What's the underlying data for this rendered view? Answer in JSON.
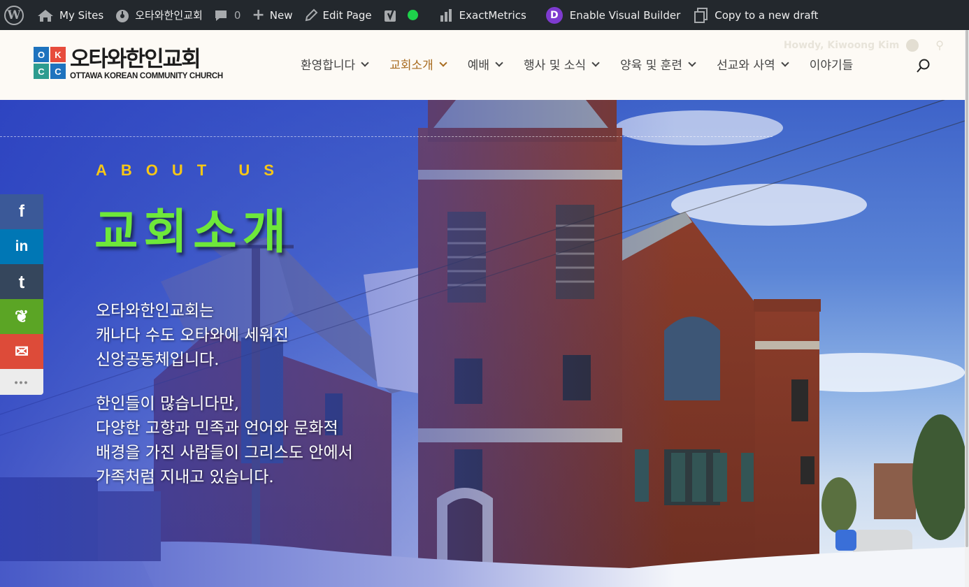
{
  "adminbar": {
    "wp_icon": "wordpress-logo-icon",
    "my_sites": "My Sites",
    "site_name": "오타와한인교회",
    "comments_count": "0",
    "new_label": "New",
    "edit_page": "Edit Page",
    "exactmetrics": "ExactMetrics",
    "visual_builder": "Enable Visual Builder",
    "copy_draft": "Copy to a new draft",
    "divi_letter": "D"
  },
  "header": {
    "logo_ko": "오타와한인교회",
    "logo_en": "OTTAWA KOREAN COMMUNITY CHURCH",
    "logo_letters": [
      "O",
      "K",
      "C",
      "C"
    ],
    "howdy": "Howdy, Kiwoong Kim",
    "nav": [
      {
        "label": "환영합니다",
        "has_dropdown": true,
        "active": false
      },
      {
        "label": "교회소개",
        "has_dropdown": true,
        "active": true
      },
      {
        "label": "예배",
        "has_dropdown": true,
        "active": false
      },
      {
        "label": "행사 및 소식",
        "has_dropdown": true,
        "active": false
      },
      {
        "label": "양육 및 훈련",
        "has_dropdown": true,
        "active": false
      },
      {
        "label": "선교와 사역",
        "has_dropdown": true,
        "active": false
      },
      {
        "label": "이야기들",
        "has_dropdown": false,
        "active": false
      }
    ]
  },
  "hero": {
    "eyebrow": "ABOUT US",
    "title": "교회소개",
    "p1": [
      "오타와한인교회는",
      "캐나다 수도 오타와에 세워진",
      "신앙공동체입니다."
    ],
    "p2": [
      "한인들이 많습니다만,",
      "다양한 고향과 민족과 언어와 문화적",
      "배경을 가진 사람들이 그리스도 안에서",
      "가족처럼 지내고 있습니다."
    ]
  },
  "social": [
    {
      "name": "facebook",
      "glyph": "f",
      "color": "#3b5998"
    },
    {
      "name": "linkedin",
      "glyph": "in",
      "color": "#0077b5"
    },
    {
      "name": "tumblr",
      "glyph": "t",
      "color": "#35465c"
    },
    {
      "name": "evernote",
      "glyph": "❦",
      "color": "#5ba525"
    },
    {
      "name": "email",
      "glyph": "✉",
      "color": "#dd4b39"
    },
    {
      "name": "more",
      "glyph": "•••",
      "color": "#ececec"
    }
  ],
  "colors": {
    "adminbar_bg": "#23282d",
    "active_nav": "#a86b1f",
    "hero_title": "#6ee83a",
    "eyebrow": "#f7c716"
  }
}
